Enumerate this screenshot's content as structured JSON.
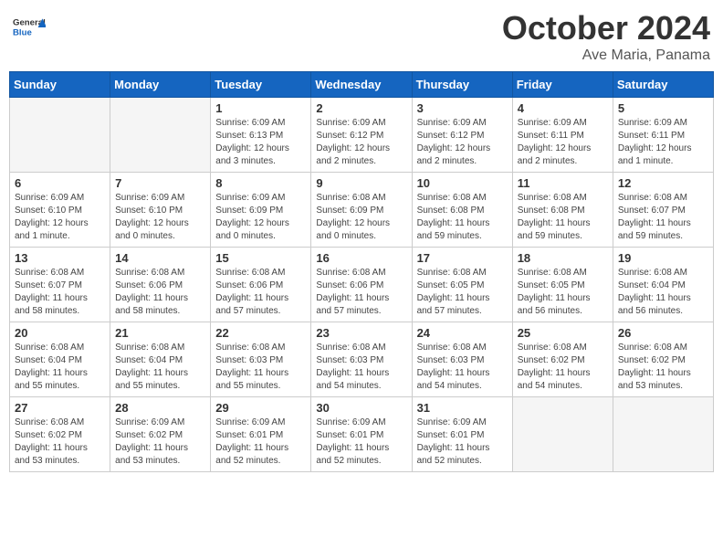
{
  "header": {
    "logo_line1": "General",
    "logo_line2": "Blue",
    "month": "October 2024",
    "location": "Ave Maria, Panama"
  },
  "weekdays": [
    "Sunday",
    "Monday",
    "Tuesday",
    "Wednesday",
    "Thursday",
    "Friday",
    "Saturday"
  ],
  "weeks": [
    [
      {
        "day": "",
        "info": ""
      },
      {
        "day": "",
        "info": ""
      },
      {
        "day": "1",
        "info": "Sunrise: 6:09 AM\nSunset: 6:13 PM\nDaylight: 12 hours\nand 3 minutes."
      },
      {
        "day": "2",
        "info": "Sunrise: 6:09 AM\nSunset: 6:12 PM\nDaylight: 12 hours\nand 2 minutes."
      },
      {
        "day": "3",
        "info": "Sunrise: 6:09 AM\nSunset: 6:12 PM\nDaylight: 12 hours\nand 2 minutes."
      },
      {
        "day": "4",
        "info": "Sunrise: 6:09 AM\nSunset: 6:11 PM\nDaylight: 12 hours\nand 2 minutes."
      },
      {
        "day": "5",
        "info": "Sunrise: 6:09 AM\nSunset: 6:11 PM\nDaylight: 12 hours\nand 1 minute."
      }
    ],
    [
      {
        "day": "6",
        "info": "Sunrise: 6:09 AM\nSunset: 6:10 PM\nDaylight: 12 hours\nand 1 minute."
      },
      {
        "day": "7",
        "info": "Sunrise: 6:09 AM\nSunset: 6:10 PM\nDaylight: 12 hours\nand 0 minutes."
      },
      {
        "day": "8",
        "info": "Sunrise: 6:09 AM\nSunset: 6:09 PM\nDaylight: 12 hours\nand 0 minutes."
      },
      {
        "day": "9",
        "info": "Sunrise: 6:08 AM\nSunset: 6:09 PM\nDaylight: 12 hours\nand 0 minutes."
      },
      {
        "day": "10",
        "info": "Sunrise: 6:08 AM\nSunset: 6:08 PM\nDaylight: 11 hours\nand 59 minutes."
      },
      {
        "day": "11",
        "info": "Sunrise: 6:08 AM\nSunset: 6:08 PM\nDaylight: 11 hours\nand 59 minutes."
      },
      {
        "day": "12",
        "info": "Sunrise: 6:08 AM\nSunset: 6:07 PM\nDaylight: 11 hours\nand 59 minutes."
      }
    ],
    [
      {
        "day": "13",
        "info": "Sunrise: 6:08 AM\nSunset: 6:07 PM\nDaylight: 11 hours\nand 58 minutes."
      },
      {
        "day": "14",
        "info": "Sunrise: 6:08 AM\nSunset: 6:06 PM\nDaylight: 11 hours\nand 58 minutes."
      },
      {
        "day": "15",
        "info": "Sunrise: 6:08 AM\nSunset: 6:06 PM\nDaylight: 11 hours\nand 57 minutes."
      },
      {
        "day": "16",
        "info": "Sunrise: 6:08 AM\nSunset: 6:06 PM\nDaylight: 11 hours\nand 57 minutes."
      },
      {
        "day": "17",
        "info": "Sunrise: 6:08 AM\nSunset: 6:05 PM\nDaylight: 11 hours\nand 57 minutes."
      },
      {
        "day": "18",
        "info": "Sunrise: 6:08 AM\nSunset: 6:05 PM\nDaylight: 11 hours\nand 56 minutes."
      },
      {
        "day": "19",
        "info": "Sunrise: 6:08 AM\nSunset: 6:04 PM\nDaylight: 11 hours\nand 56 minutes."
      }
    ],
    [
      {
        "day": "20",
        "info": "Sunrise: 6:08 AM\nSunset: 6:04 PM\nDaylight: 11 hours\nand 55 minutes."
      },
      {
        "day": "21",
        "info": "Sunrise: 6:08 AM\nSunset: 6:04 PM\nDaylight: 11 hours\nand 55 minutes."
      },
      {
        "day": "22",
        "info": "Sunrise: 6:08 AM\nSunset: 6:03 PM\nDaylight: 11 hours\nand 55 minutes."
      },
      {
        "day": "23",
        "info": "Sunrise: 6:08 AM\nSunset: 6:03 PM\nDaylight: 11 hours\nand 54 minutes."
      },
      {
        "day": "24",
        "info": "Sunrise: 6:08 AM\nSunset: 6:03 PM\nDaylight: 11 hours\nand 54 minutes."
      },
      {
        "day": "25",
        "info": "Sunrise: 6:08 AM\nSunset: 6:02 PM\nDaylight: 11 hours\nand 54 minutes."
      },
      {
        "day": "26",
        "info": "Sunrise: 6:08 AM\nSunset: 6:02 PM\nDaylight: 11 hours\nand 53 minutes."
      }
    ],
    [
      {
        "day": "27",
        "info": "Sunrise: 6:08 AM\nSunset: 6:02 PM\nDaylight: 11 hours\nand 53 minutes."
      },
      {
        "day": "28",
        "info": "Sunrise: 6:09 AM\nSunset: 6:02 PM\nDaylight: 11 hours\nand 53 minutes."
      },
      {
        "day": "29",
        "info": "Sunrise: 6:09 AM\nSunset: 6:01 PM\nDaylight: 11 hours\nand 52 minutes."
      },
      {
        "day": "30",
        "info": "Sunrise: 6:09 AM\nSunset: 6:01 PM\nDaylight: 11 hours\nand 52 minutes."
      },
      {
        "day": "31",
        "info": "Sunrise: 6:09 AM\nSunset: 6:01 PM\nDaylight: 11 hours\nand 52 minutes."
      },
      {
        "day": "",
        "info": ""
      },
      {
        "day": "",
        "info": ""
      }
    ]
  ]
}
